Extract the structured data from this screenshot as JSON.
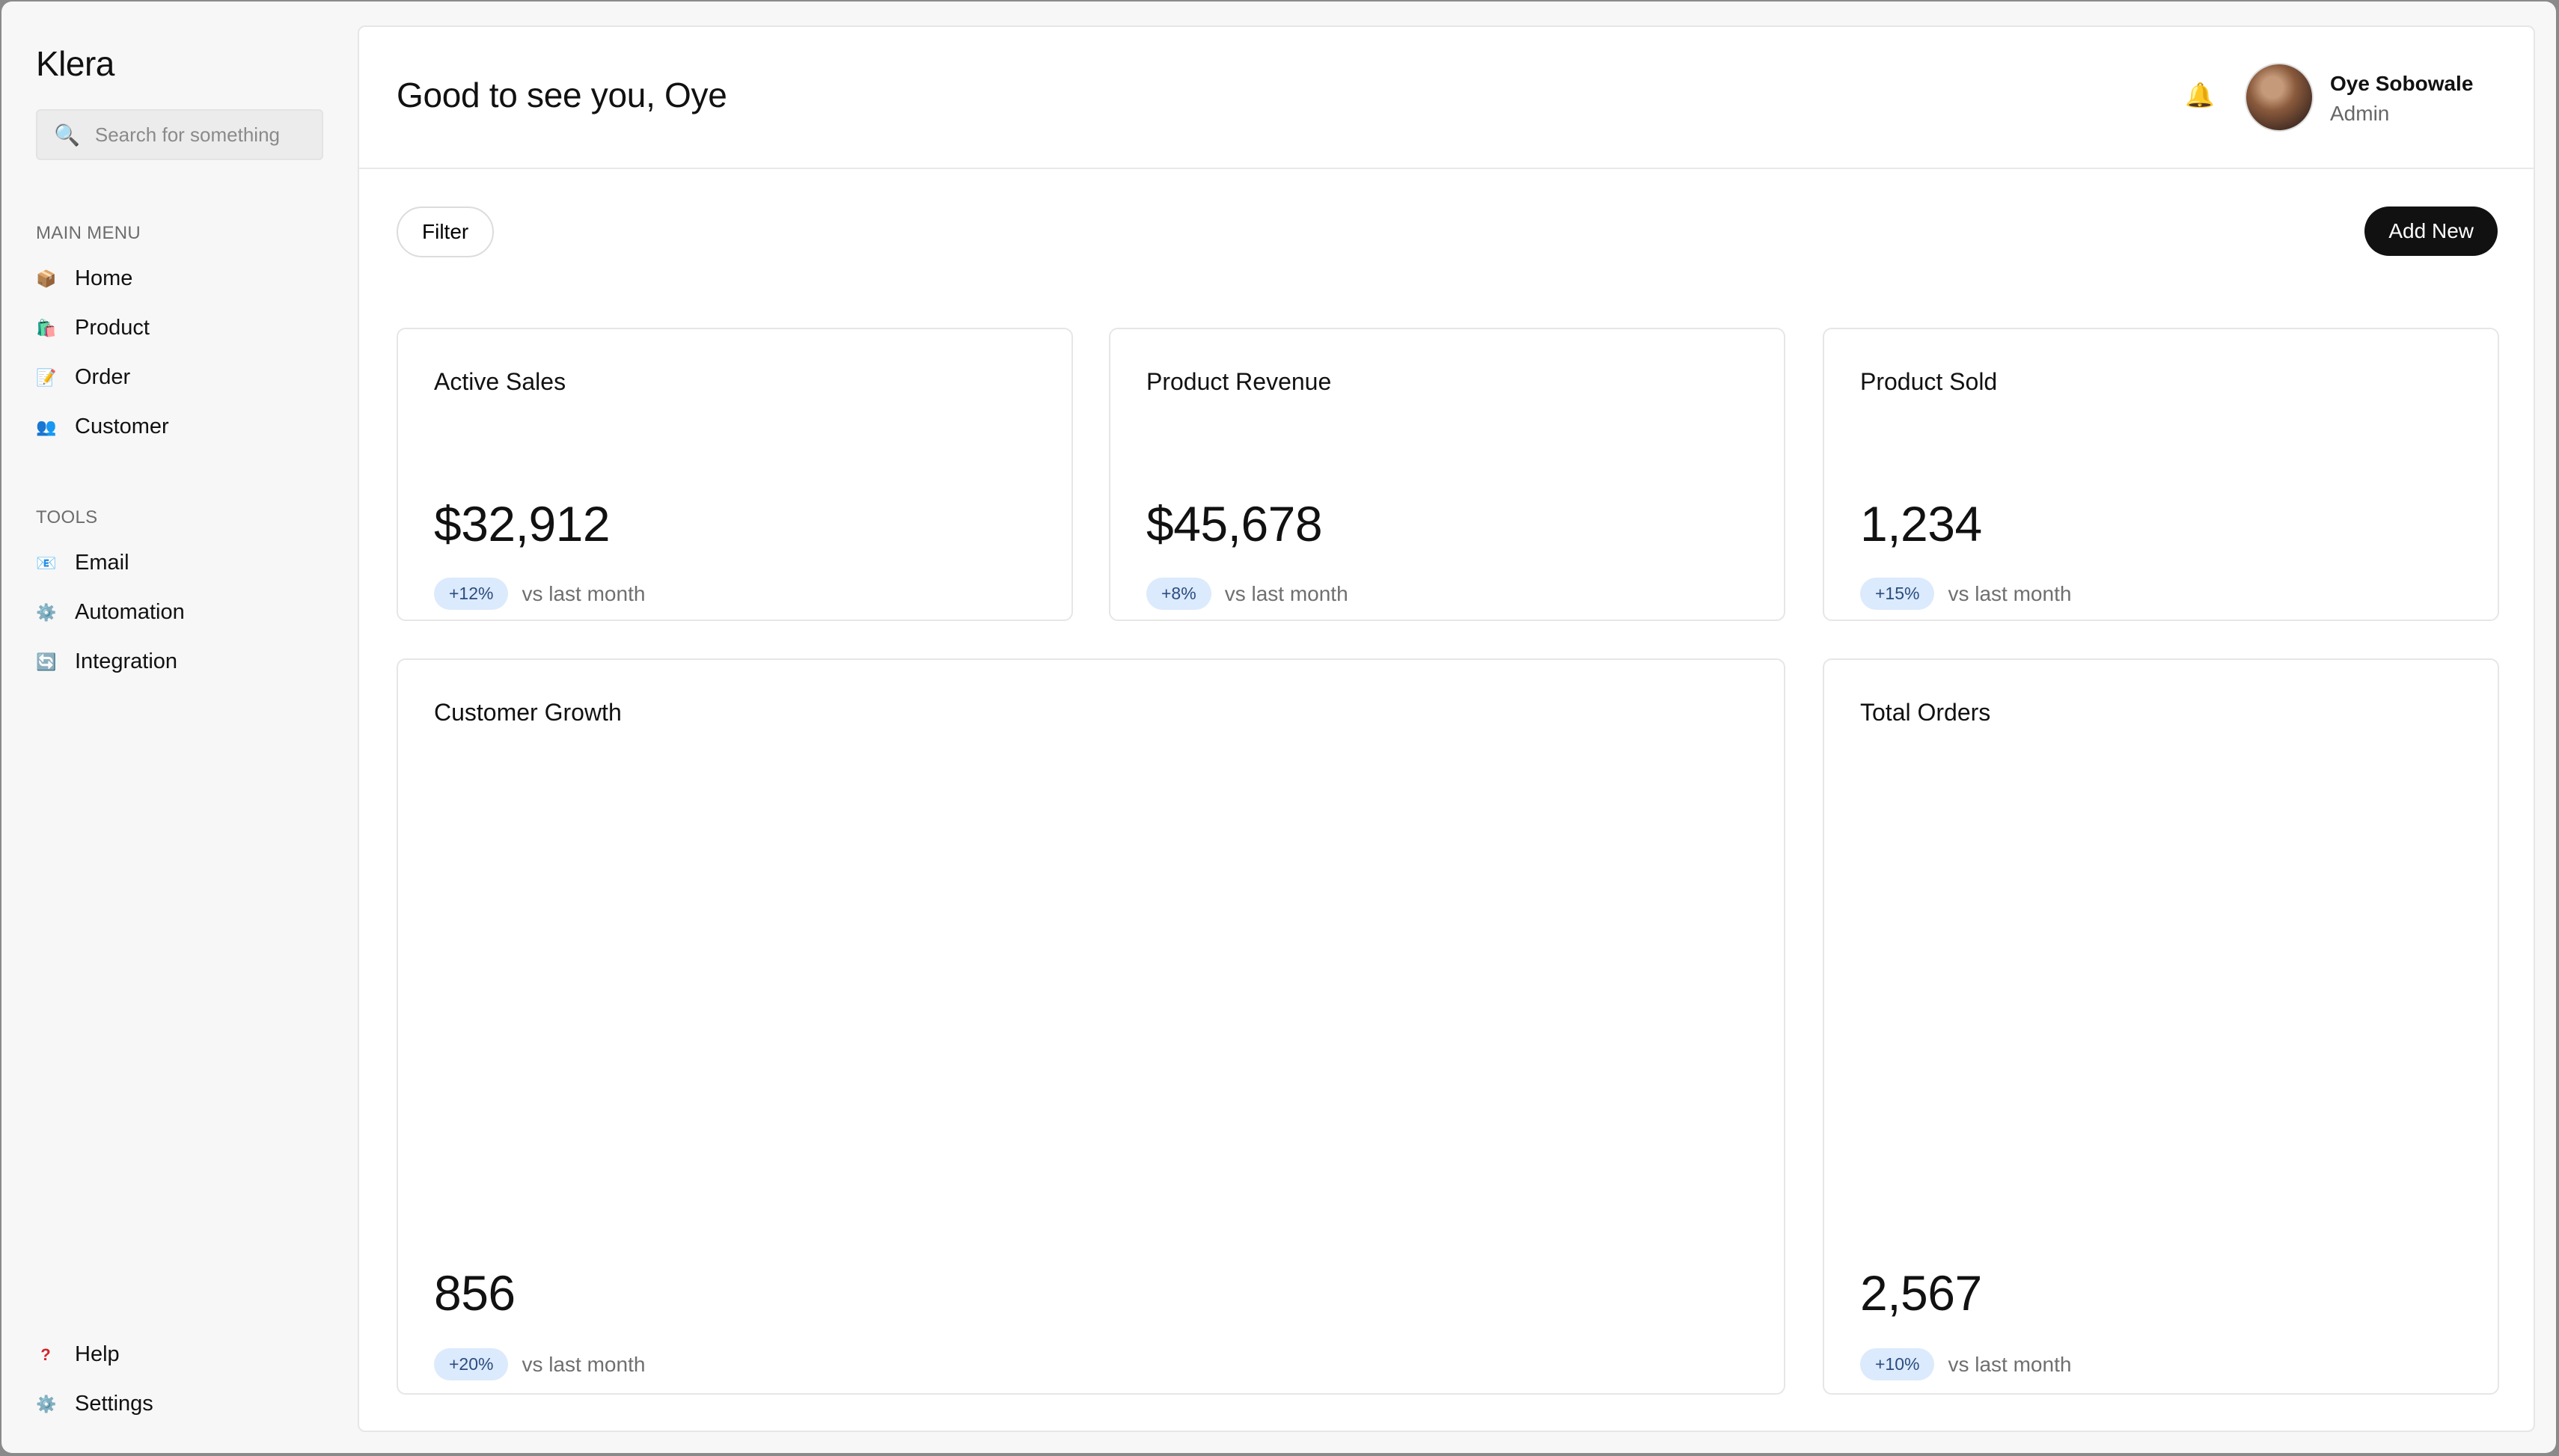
{
  "app": {
    "brand": "Klera"
  },
  "search": {
    "placeholder": "Search for something"
  },
  "sidebar": {
    "main_menu_label": "MAIN MENU",
    "main_items": [
      {
        "label": "Home",
        "icon": "box-icon"
      },
      {
        "label": "Product",
        "icon": "shopping-bag-icon"
      },
      {
        "label": "Order",
        "icon": "memo-icon"
      },
      {
        "label": "Customer",
        "icon": "users-icon"
      }
    ],
    "tools_label": "TOOLS",
    "tool_items": [
      {
        "label": "Email",
        "icon": "email-icon"
      },
      {
        "label": "Automation",
        "icon": "gear-icon"
      },
      {
        "label": "Integration",
        "icon": "sync-icon"
      }
    ],
    "bottom_items": [
      {
        "label": "Help",
        "icon": "question-icon"
      },
      {
        "label": "Settings",
        "icon": "gear-icon"
      }
    ]
  },
  "header": {
    "greeting": "Good to see you, Oye",
    "user": {
      "name": "Oye Sobowale",
      "role": "Admin"
    }
  },
  "toolbar": {
    "filter_label": "Filter",
    "add_label": "Add New"
  },
  "cards": {
    "active_sales": {
      "title": "Active Sales",
      "value": "$32,912",
      "change": "+12%",
      "compare": "vs last month"
    },
    "product_revenue": {
      "title": "Product Revenue",
      "value": "$45,678",
      "change": "+8%",
      "compare": "vs last month"
    },
    "product_sold": {
      "title": "Product Sold",
      "value": "1,234",
      "change": "+15%",
      "compare": "vs last month"
    },
    "customer_growth": {
      "title": "Customer Growth",
      "value": "856",
      "change": "+20%",
      "compare": "vs last month"
    },
    "total_orders": {
      "title": "Total Orders",
      "value": "2,567",
      "change": "+10%",
      "compare": "vs last month"
    }
  },
  "colors": {
    "accent": "#111111",
    "badge_bg": "#dbeafc",
    "badge_text": "#2b4c7e"
  }
}
